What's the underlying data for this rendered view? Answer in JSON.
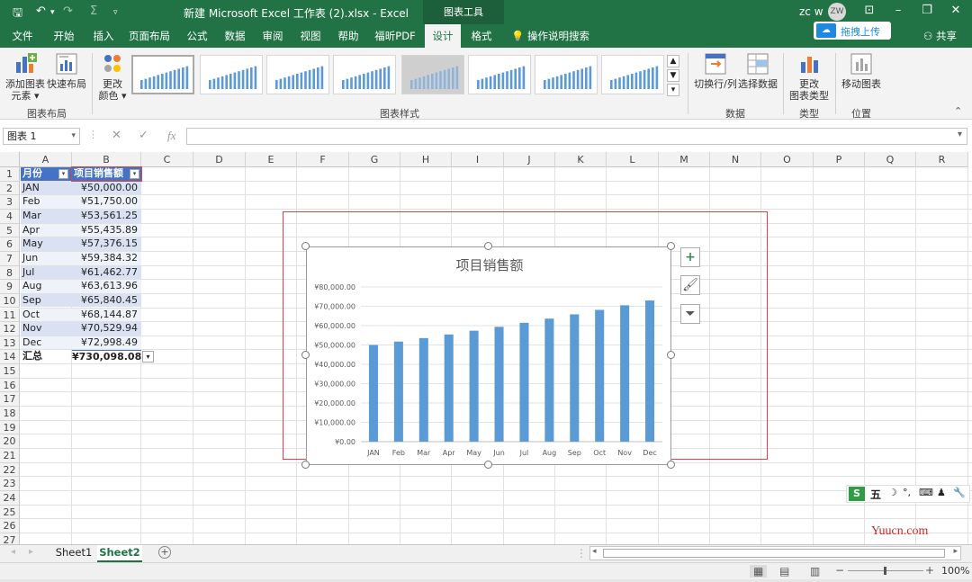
{
  "titlebar": {
    "title": "新建 Microsoft Excel 工作表 (2).xlsx - Excel",
    "context_tab": "图表工具",
    "user_name": "zc w",
    "avatar_initials": "ZW"
  },
  "tabs": [
    {
      "label": "文件"
    },
    {
      "label": "开始"
    },
    {
      "label": "插入"
    },
    {
      "label": "页面布局"
    },
    {
      "label": "公式"
    },
    {
      "label": "数据"
    },
    {
      "label": "审阅"
    },
    {
      "label": "视图"
    },
    {
      "label": "帮助"
    },
    {
      "label": "福昕PDF"
    },
    {
      "label": "设计"
    },
    {
      "label": "格式"
    }
  ],
  "tell_me": "操作说明搜索",
  "upload_label": "拖拽上传",
  "share_label": "共享",
  "ribbon": {
    "add_element": "添加图表元素",
    "add_element_line1": "添加图表",
    "add_element_line2": "元素",
    "quick_layout": "快速布局",
    "change_colors_line1": "更改",
    "change_colors_line2": "颜色",
    "group_layout": "图表布局",
    "group_styles": "图表样式",
    "switch_row_col": "切换行/列",
    "select_data": "选择数据",
    "group_data": "数据",
    "change_type_line1": "更改",
    "change_type_line2": "图表类型",
    "group_type": "类型",
    "move_chart": "移动图表",
    "group_location": "位置"
  },
  "formula": {
    "name_box": "图表 1",
    "fx": "fx",
    "value": ""
  },
  "columns": [
    "A",
    "B",
    "C",
    "D",
    "E",
    "F",
    "G",
    "H",
    "I",
    "J",
    "K",
    "L",
    "M",
    "N",
    "O",
    "P",
    "Q",
    "R"
  ],
  "rows": [
    "1",
    "2",
    "3",
    "4",
    "5",
    "6",
    "7",
    "8",
    "9",
    "10",
    "11",
    "12",
    "13",
    "14",
    "15",
    "16",
    "17",
    "18",
    "19",
    "20",
    "21",
    "22",
    "23",
    "24",
    "25",
    "26",
    "27"
  ],
  "table": {
    "header_month": "月份",
    "header_sales": "项目销售额",
    "data": [
      {
        "month": "JAN",
        "sales": "¥50,000.00"
      },
      {
        "month": "Feb",
        "sales": "¥51,750.00"
      },
      {
        "month": "Mar",
        "sales": "¥53,561.25"
      },
      {
        "month": "Apr",
        "sales": "¥55,435.89"
      },
      {
        "month": "May",
        "sales": "¥57,376.15"
      },
      {
        "month": "Jun",
        "sales": "¥59,384.32"
      },
      {
        "month": "Jul",
        "sales": "¥61,462.77"
      },
      {
        "month": "Aug",
        "sales": "¥63,613.96"
      },
      {
        "month": "Sep",
        "sales": "¥65,840.45"
      },
      {
        "month": "Oct",
        "sales": "¥68,144.87"
      },
      {
        "month": "Nov",
        "sales": "¥70,529.94"
      },
      {
        "month": "Dec",
        "sales": "¥72,998.49"
      }
    ],
    "total_label": "汇总",
    "total_value": "¥730,098.08"
  },
  "chart_data": {
    "type": "bar",
    "title": "项目销售额",
    "categories": [
      "JAN",
      "Feb",
      "Mar",
      "Apr",
      "May",
      "Jun",
      "Jul",
      "Aug",
      "Sep",
      "Oct",
      "Nov",
      "Dec"
    ],
    "values": [
      50000,
      51750,
      53561.25,
      55435.89,
      57376.15,
      59384.32,
      61462.77,
      63613.96,
      65840.45,
      68144.87,
      70529.94,
      72998.49
    ],
    "ylim": [
      0,
      80000
    ],
    "yticks": [
      "¥0.00",
      "¥10,000.00",
      "¥20,000.00",
      "¥30,000.00",
      "¥40,000.00",
      "¥50,000.00",
      "¥60,000.00",
      "¥70,000.00",
      "¥80,000.00"
    ],
    "grid": true,
    "bar_color": "#5b9bd5",
    "xlabel": "",
    "ylabel": ""
  },
  "sheets": [
    {
      "label": "Sheet1"
    },
    {
      "label": "Sheet2"
    }
  ],
  "status": {
    "zoom": "100%"
  },
  "ime": {
    "mode": "五"
  },
  "watermark": "Yuucn.com",
  "colors": {
    "excel_green": "#217346",
    "table_header": "#4472c4",
    "selection_red": "#d64545"
  }
}
